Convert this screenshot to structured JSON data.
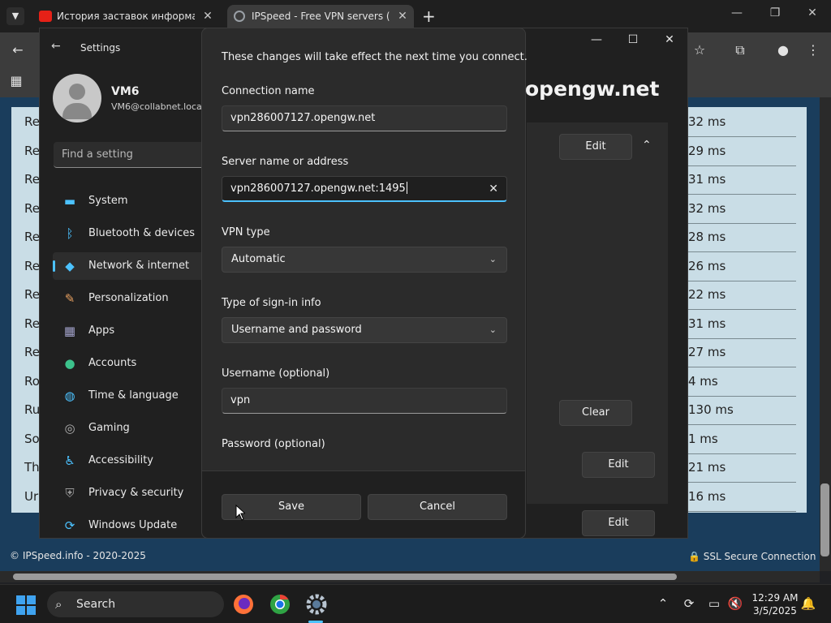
{
  "browser": {
    "tabs": [
      {
        "title": "История заставок информаци",
        "favicon_color": "#e62117"
      },
      {
        "title": "IPSpeed - Free VPN servers (SS",
        "favicon_color": "#9aa0a6"
      }
    ],
    "new_tab": "+"
  },
  "webpage": {
    "rows_left": [
      "Re",
      "Re",
      "Re",
      "Re",
      "Re",
      "Re",
      "Re",
      "Re",
      "Re",
      "Ro",
      "Ru",
      "So",
      "Th",
      "Ur"
    ],
    "rows_right": [
      "32 ms",
      "29 ms",
      "31 ms",
      "32 ms",
      "28 ms",
      "26 ms",
      "22 ms",
      "31 ms",
      "27 ms",
      "4 ms",
      "130 ms",
      "1 ms",
      "21 ms",
      "16 ms"
    ],
    "footer_left": "© IPSpeed.info - 2020-2025",
    "footer_right": "SSL Secure Connection"
  },
  "settings": {
    "title": "Settings",
    "user_name": "VM6",
    "user_email": "VM6@collabnet.loca",
    "search_placeholder": "Find a setting",
    "nav": [
      {
        "label": "System",
        "icon": "monitor-icon",
        "color": "#4cc2ff"
      },
      {
        "label": "Bluetooth & devices",
        "icon": "bluetooth-icon",
        "color": "#4cc2ff"
      },
      {
        "label": "Network & internet",
        "icon": "wifi-icon",
        "color": "#4cc2ff"
      },
      {
        "label": "Personalization",
        "icon": "brush-icon",
        "color": "#e8a060"
      },
      {
        "label": "Apps",
        "icon": "apps-icon",
        "color": "#a0a0c8"
      },
      {
        "label": "Accounts",
        "icon": "person-icon",
        "color": "#3cc28c"
      },
      {
        "label": "Time & language",
        "icon": "globe-clock-icon",
        "color": "#4cc2ff"
      },
      {
        "label": "Gaming",
        "icon": "gamepad-icon",
        "color": "#b0b0b0"
      },
      {
        "label": "Accessibility",
        "icon": "accessibility-icon",
        "color": "#4cc2ff"
      },
      {
        "label": "Privacy & security",
        "icon": "shield-icon",
        "color": "#9a9a9a"
      },
      {
        "label": "Windows Update",
        "icon": "update-icon",
        "color": "#4cc2ff"
      }
    ],
    "page_title_fragment": "opengw.net",
    "buttons": {
      "edit": "Edit",
      "clear": "Clear"
    }
  },
  "dialog": {
    "intro": "These changes will take effect the next time you connect.",
    "connection_name_label": "Connection name",
    "connection_name_value": "vpn286007127.opengw.net",
    "server_label": "Server name or address",
    "server_value": "vpn286007127.opengw.net:1495",
    "vpn_type_label": "VPN type",
    "vpn_type_value": "Automatic",
    "signin_label": "Type of sign-in info",
    "signin_value": "Username and password",
    "username_label": "Username (optional)",
    "username_value": "vpn",
    "password_label": "Password (optional)",
    "save": "Save",
    "cancel": "Cancel"
  },
  "taskbar": {
    "search": "Search",
    "time": "12:29 AM",
    "date": "3/5/2025"
  }
}
